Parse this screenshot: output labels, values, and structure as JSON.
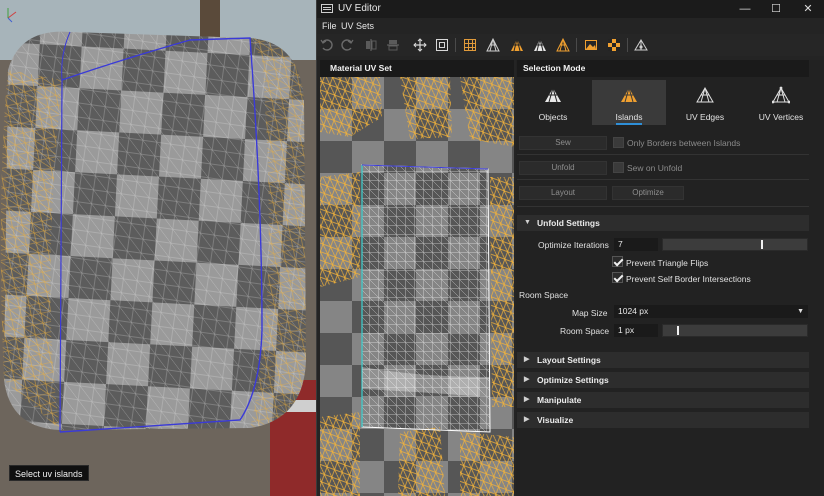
{
  "viewport": {
    "tooltip": "Select uv islands",
    "axis_label": "Z"
  },
  "window": {
    "title": "UV Editor",
    "controls": {
      "minimize": "—",
      "maximize": "☐",
      "close": "✕"
    }
  },
  "menu": [
    "File",
    "UV Sets"
  ],
  "toolbar": {
    "icons": [
      "undo-icon",
      "redo-icon",
      "mirror-horizontal-icon",
      "mirror-vertical-icon",
      "move-icon",
      "fit-icon",
      "grid-icon",
      "uv-vertices-icon",
      "islands-icon",
      "objects-icon",
      "uv-edges-icon",
      "image-icon",
      "checker-icon",
      "pin-icon"
    ]
  },
  "uv_panel": {
    "header": "Material UV Set"
  },
  "selection_panel": {
    "header": "Selection Mode",
    "modes": [
      {
        "label": "Objects",
        "active": false
      },
      {
        "label": "Islands",
        "active": true
      },
      {
        "label": "UV Edges",
        "active": false
      },
      {
        "label": "UV Vertices",
        "active": false
      }
    ],
    "sew_button": "Sew",
    "only_borders_label": "Only Borders between Islands",
    "unfold_button": "Unfold",
    "sew_on_unfold_label": "Sew on Unfold",
    "layout_button": "Layout",
    "optimize_button": "Optimize"
  },
  "unfold_settings": {
    "title": "Unfold Settings",
    "optimize_iterations_label": "Optimize Iterations",
    "optimize_iterations_value": "7",
    "optimize_iterations_slider": 0.69,
    "prevent_triangle_flips_label": "Prevent Triangle Flips",
    "prevent_triangle_flips": true,
    "prevent_self_border_label": "Prevent Self Border Intersections",
    "prevent_self_border": true,
    "room_space_heading": "Room Space",
    "map_size_label": "Map Size",
    "map_size_value": "1024 px",
    "room_space_label": "Room Space",
    "room_space_value": "1 px",
    "room_space_slider": 0.1
  },
  "collapsed_sections": [
    "Layout Settings",
    "Optimize Settings",
    "Manipulate",
    "Visualize"
  ],
  "colors": {
    "accent": "#2e8fd8",
    "island_icon": "#f0a030",
    "mesh_wire": "#f2b23a",
    "uv_edge": "#3a3ad8"
  }
}
